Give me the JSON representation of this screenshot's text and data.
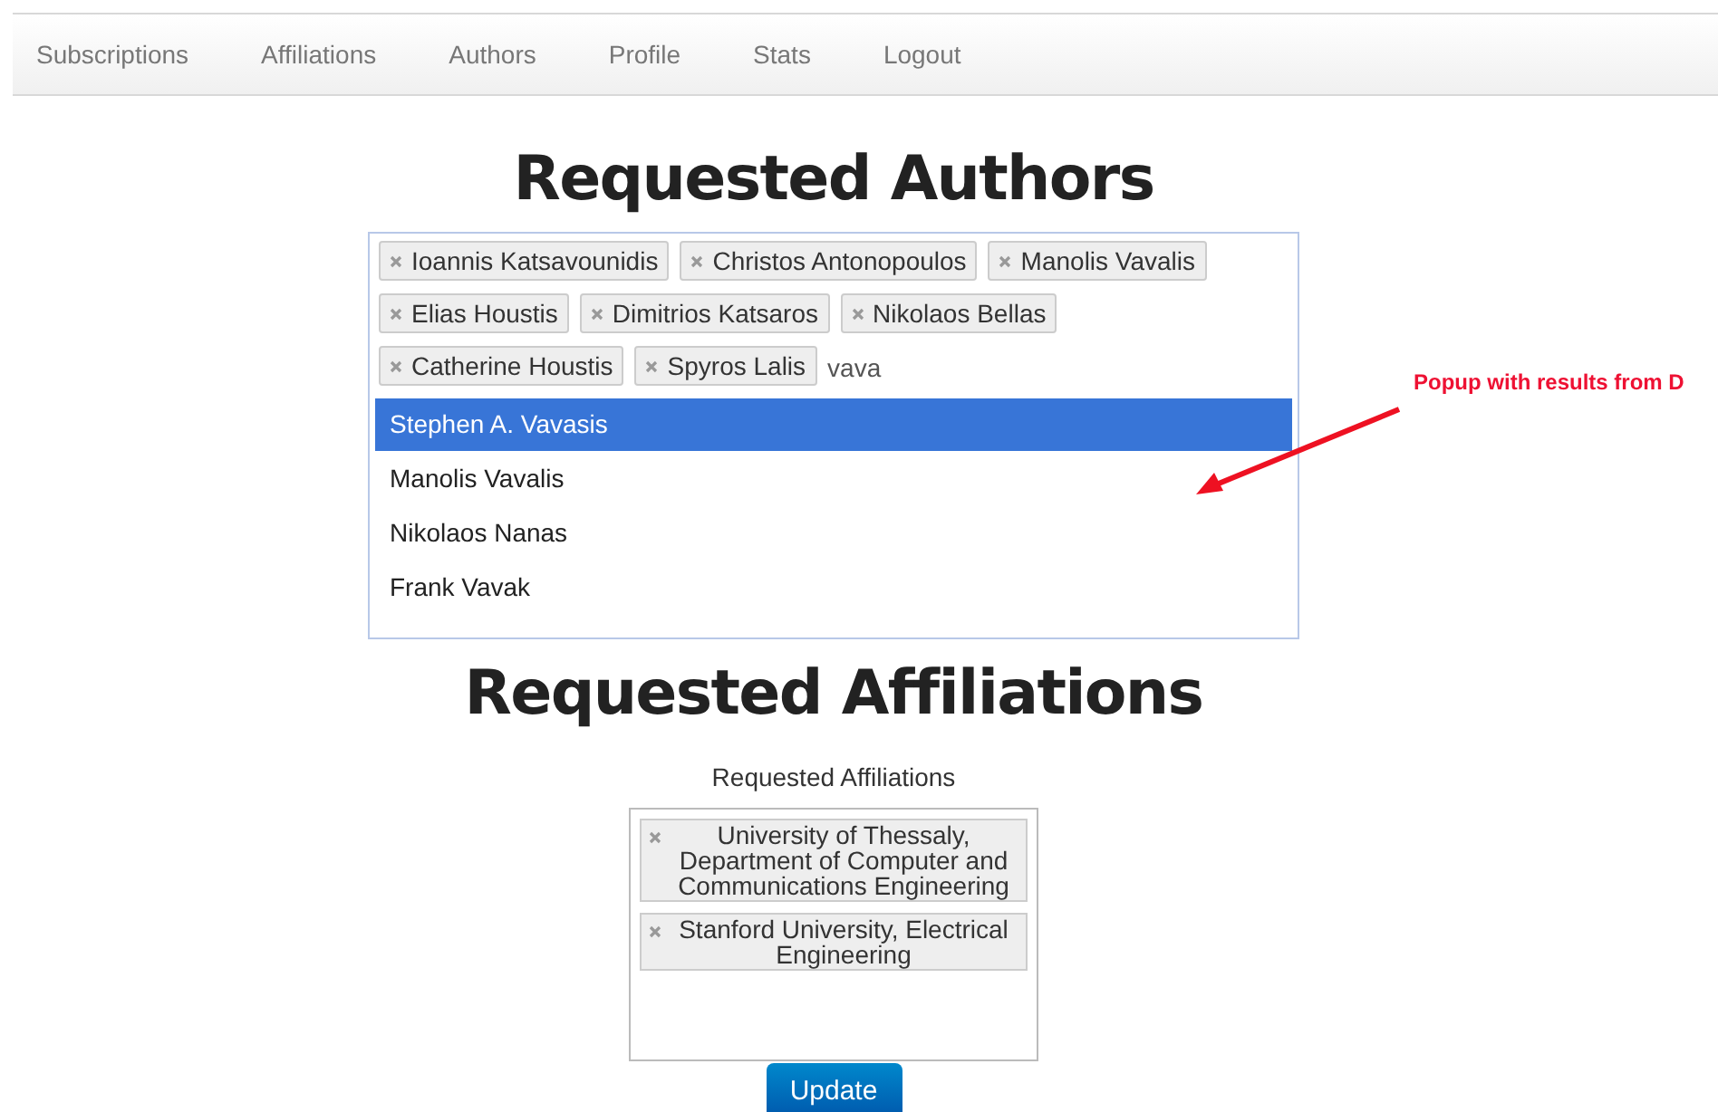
{
  "nav": {
    "items": [
      {
        "label": "Subscriptions"
      },
      {
        "label": "Affiliations"
      },
      {
        "label": "Authors"
      },
      {
        "label": "Profile"
      },
      {
        "label": "Stats"
      },
      {
        "label": "Logout"
      }
    ]
  },
  "authors_section": {
    "title": "Requested Authors",
    "tags": [
      "Ioannis Katsavounidis",
      "Christos Antonopoulos",
      "Manolis Vavalis",
      "Elias Houstis",
      "Dimitrios Katsaros",
      "Nikolaos Bellas",
      "Catherine Houstis",
      "Spyros Lalis"
    ],
    "query": "vava",
    "results": [
      {
        "label": "Stephen A. Vavasis",
        "selected": true
      },
      {
        "label": "Manolis Vavalis",
        "selected": false
      },
      {
        "label": "Nikolaos Nanas",
        "selected": false
      },
      {
        "label": "Frank Vavak",
        "selected": false
      }
    ]
  },
  "annotation": {
    "text": "Popup with results from D"
  },
  "affiliations_section": {
    "title": "Requested Affiliations",
    "label": "Requested Affiliations",
    "tags": [
      "University of Thessaly, Department of Computer and Communications Engineering",
      "Stanford University, Electrical Engineering"
    ]
  },
  "update_button": "Update"
}
